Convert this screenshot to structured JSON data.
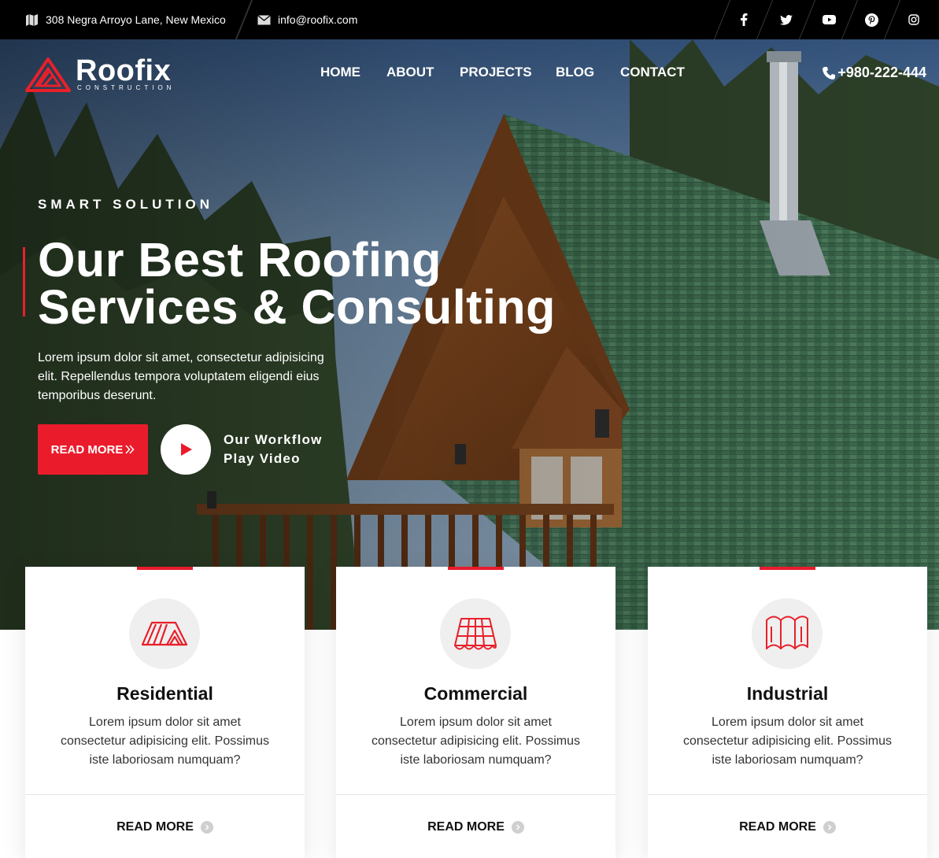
{
  "topbar": {
    "address": "308 Negra Arroyo Lane, New Mexico",
    "email": "info@roofix.com",
    "social": [
      "facebook-icon",
      "twitter-icon",
      "youtube-icon",
      "pinterest-icon",
      "instagram-icon"
    ]
  },
  "header": {
    "logo_name": "Roofix",
    "logo_sub": "CONSTRUCTION",
    "nav": [
      "HOME",
      "ABOUT",
      "PROJECTS",
      "BLOG",
      "CONTACT"
    ],
    "phone": "+980-222-444"
  },
  "hero": {
    "kicker": "SMART SOLUTION",
    "headline_line1": "Our Best Roofing",
    "headline_line2": "Services & Consulting",
    "lead": "Lorem ipsum dolor sit amet, consectetur adipisicing elit. Repellendus tempora voluptatem eligendi eius temporibus deserunt.",
    "button": "READ MORE",
    "video_line1": "Our Workflow",
    "video_line2": "Play Video"
  },
  "cards": [
    {
      "title": "Residential",
      "text": "Lorem ipsum dolor sit amet consectetur adipisicing elit. Possimus iste laboriosam numquam?",
      "link": "READ MORE",
      "icon": "residential-roof-icon"
    },
    {
      "title": "Commercial",
      "text": "Lorem ipsum dolor sit amet consectetur adipisicing elit. Possimus iste laboriosam numquam?",
      "link": "READ MORE",
      "icon": "commercial-tile-icon"
    },
    {
      "title": "Industrial",
      "text": "Lorem ipsum dolor sit amet consectetur adipisicing elit. Possimus iste laboriosam numquam?",
      "link": "READ MORE",
      "icon": "industrial-sheet-icon"
    }
  ],
  "colors": {
    "accent": "#ea1c2c",
    "topbar": "#000000",
    "text": "#111111"
  }
}
